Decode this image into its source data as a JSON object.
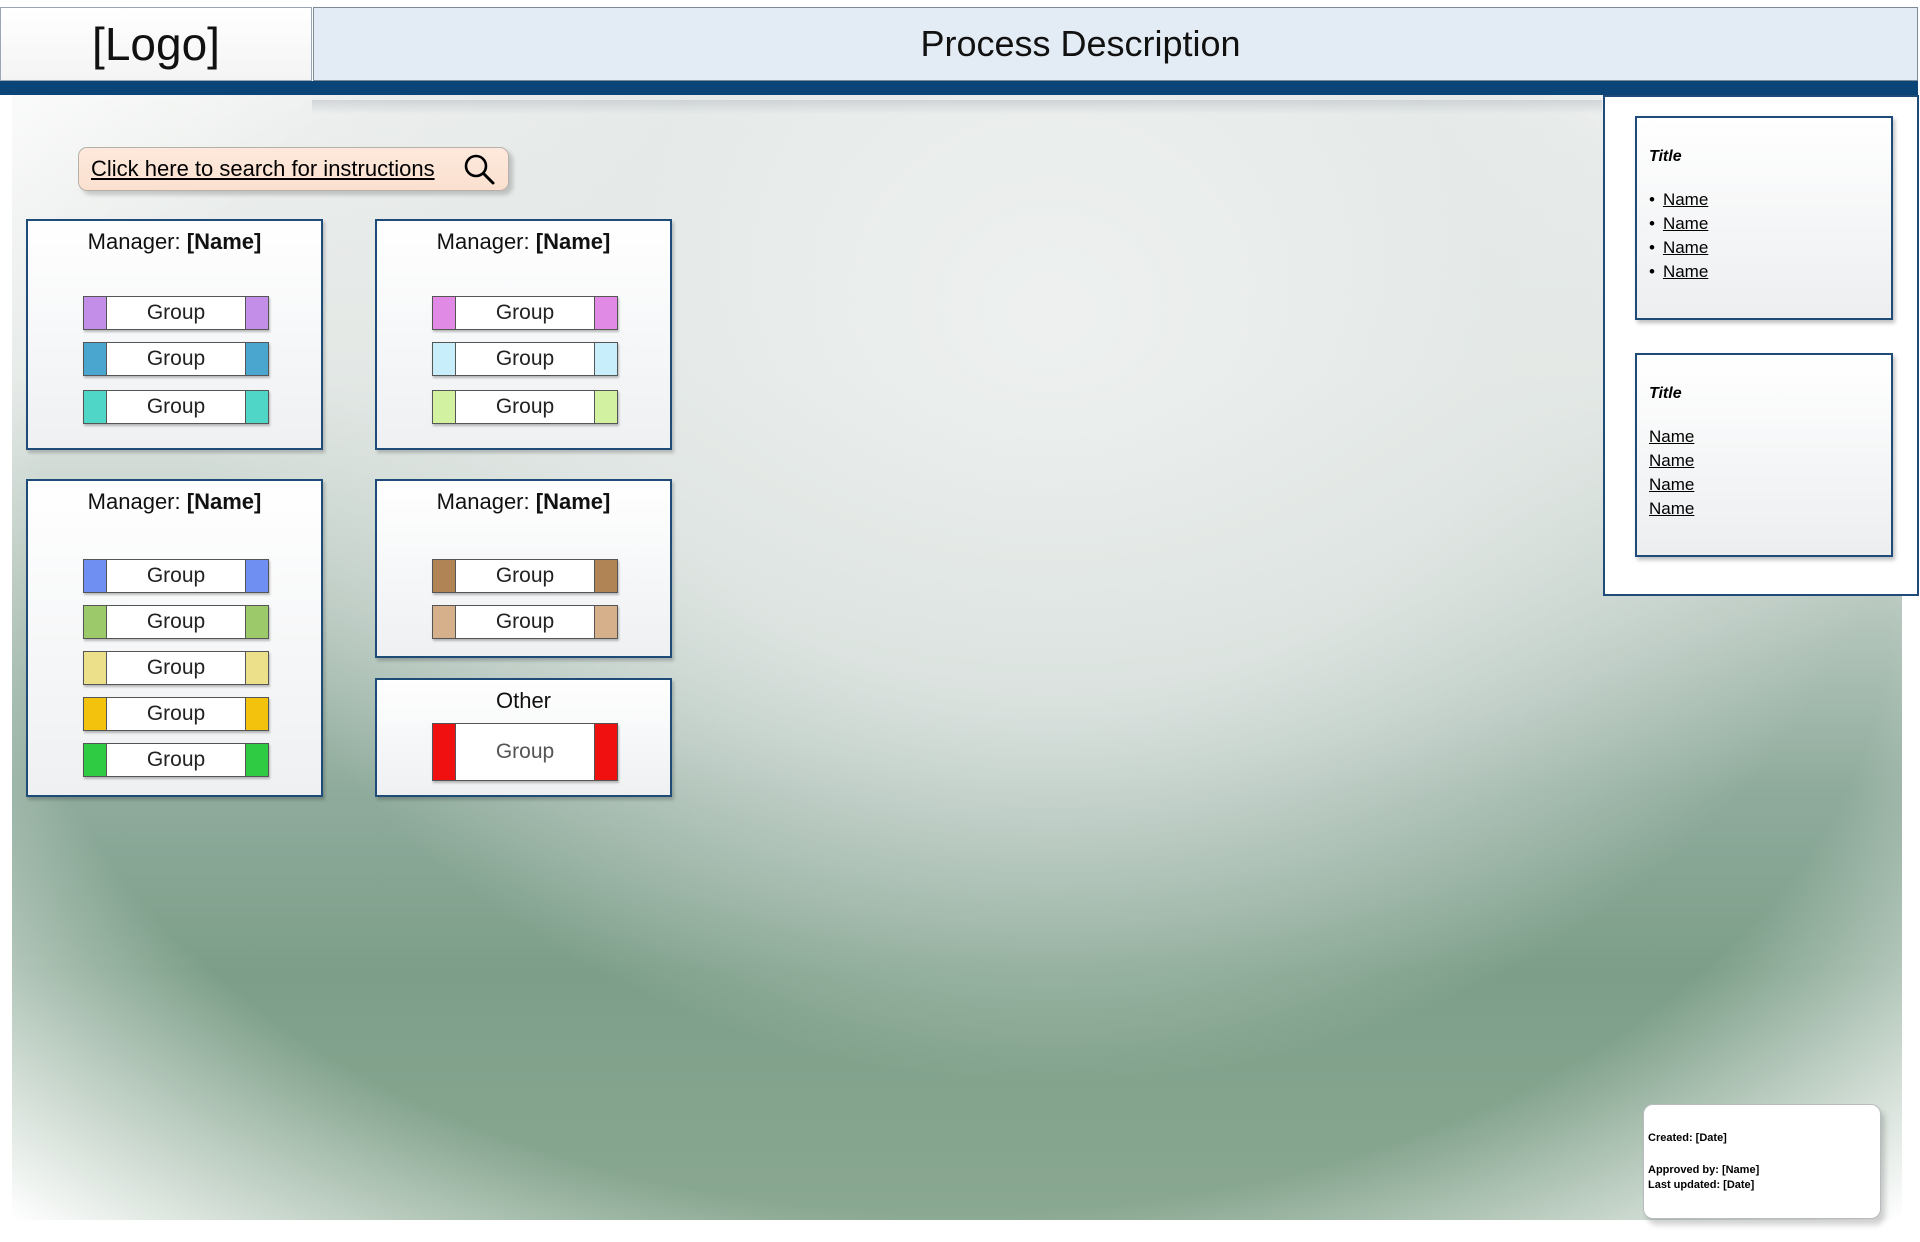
{
  "header": {
    "logo_text": "[Logo]",
    "title": "Process Description"
  },
  "search": {
    "label": "Click here to search for instructions",
    "icon": "search-icon"
  },
  "cards": [
    {
      "manager_label": "Manager:",
      "manager_name": "[Name]",
      "groups": [
        {
          "label": "Group",
          "color": "#c38ee8"
        },
        {
          "label": "Group",
          "color": "#4aa5cf"
        },
        {
          "label": "Group",
          "color": "#4fd6c6"
        }
      ]
    },
    {
      "manager_label": "Manager:",
      "manager_name": "[Name]",
      "groups": [
        {
          "label": "Group",
          "color": "#e08ae6"
        },
        {
          "label": "Group",
          "color": "#c7eefa"
        },
        {
          "label": "Group",
          "color": "#d3f2a1"
        }
      ]
    },
    {
      "manager_label": "Manager:",
      "manager_name": "[Name]",
      "groups": [
        {
          "label": "Group",
          "color": "#6f8ff2"
        },
        {
          "label": "Group",
          "color": "#9cc96a"
        },
        {
          "label": "Group",
          "color": "#ece18a"
        },
        {
          "label": "Group",
          "color": "#f2c20d"
        },
        {
          "label": "Group",
          "color": "#2fcc43"
        }
      ]
    },
    {
      "manager_label": "Manager:",
      "manager_name": "[Name]",
      "groups": [
        {
          "label": "Group",
          "color": "#b08454"
        },
        {
          "label": "Group",
          "color": "#d5b08a"
        }
      ]
    },
    {
      "manager_label": "Other",
      "groups": [
        {
          "label": "Group",
          "color": "#f01010"
        }
      ]
    }
  ],
  "links": {
    "box1": {
      "title": "Title",
      "items": [
        "Name",
        "Name",
        "Name",
        "Name"
      ]
    },
    "box2": {
      "title": "Title",
      "items": [
        "Name",
        "Name",
        "Name",
        "Name"
      ]
    }
  },
  "footer": {
    "created": "Created: [Date]",
    "approved": "Approved by: [Name]",
    "updated": "Last updated: [Date]"
  }
}
